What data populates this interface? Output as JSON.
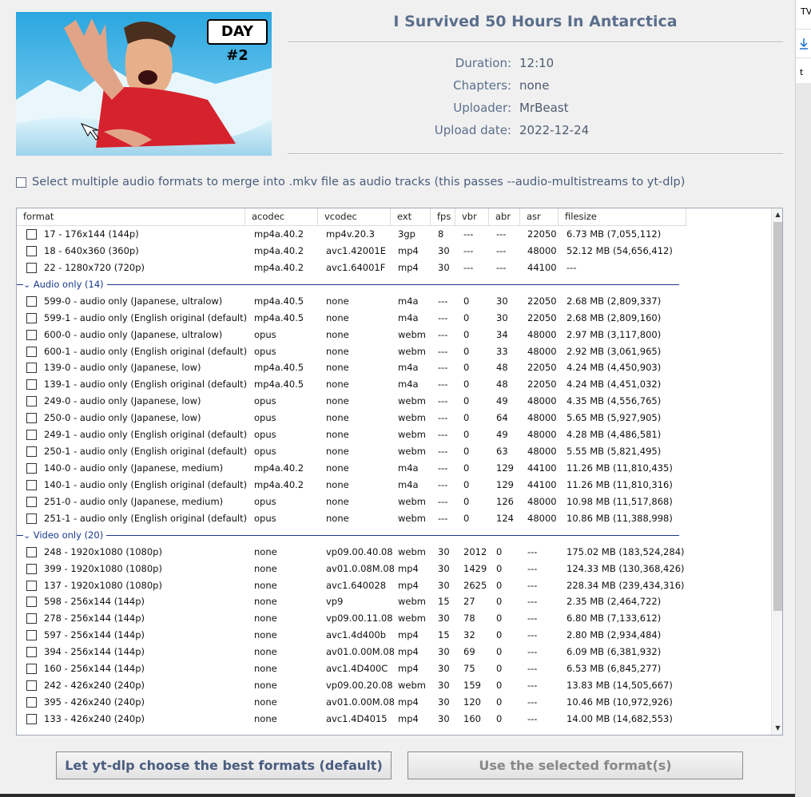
{
  "thumbnail": {
    "overlay_text": "DAY #2"
  },
  "video": {
    "title": "I Survived 50 Hours In Antarctica",
    "meta": [
      {
        "key": "Duration:",
        "value": "12:10"
      },
      {
        "key": "Chapters:",
        "value": "none"
      },
      {
        "key": "Uploader:",
        "value": "MrBeast"
      },
      {
        "key": "Upload date:",
        "value": "2022-12-24"
      }
    ]
  },
  "options": {
    "multi_audio_label": "Select multiple audio formats to merge into .mkv file as audio tracks (this passes --audio-multistreams to yt-dlp)"
  },
  "table": {
    "columns": [
      "format",
      "acodec",
      "vcodec",
      "ext",
      "fps",
      "vbr",
      "abr",
      "asr",
      "filesize"
    ],
    "items": [
      {
        "kind": "row",
        "cells": [
          "17 - 176x144 (144p)",
          "mp4a.40.2",
          "mp4v.20.3",
          "3gp",
          "8",
          "---",
          "---",
          "22050",
          "6.73 MB (7,055,112)"
        ]
      },
      {
        "kind": "row",
        "cells": [
          "18 - 640x360 (360p)",
          "mp4a.40.2",
          "avc1.42001E",
          "mp4",
          "30",
          "---",
          "---",
          "48000",
          "52.12 MB (54,656,412)"
        ]
      },
      {
        "kind": "row",
        "cells": [
          "22 - 1280x720 (720p)",
          "mp4a.40.2",
          "avc1.64001F",
          "mp4",
          "30",
          "---",
          "---",
          "44100",
          "---"
        ]
      },
      {
        "kind": "group",
        "label": "Audio only  (14)"
      },
      {
        "kind": "row",
        "cells": [
          "599-0 - audio only (Japanese, ultralow)",
          "mp4a.40.5",
          "none",
          "m4a",
          "---",
          "0",
          "30",
          "22050",
          "2.68 MB (2,809,337)"
        ]
      },
      {
        "kind": "row",
        "cells": [
          "599-1 - audio only (English original (default), ...",
          "mp4a.40.5",
          "none",
          "m4a",
          "---",
          "0",
          "30",
          "22050",
          "2.68 MB (2,809,160)"
        ]
      },
      {
        "kind": "row",
        "cells": [
          "600-0 - audio only (Japanese, ultralow)",
          "opus",
          "none",
          "webm",
          "---",
          "0",
          "34",
          "48000",
          "2.97 MB (3,117,800)"
        ]
      },
      {
        "kind": "row",
        "cells": [
          "600-1 - audio only (English original (default), ...",
          "opus",
          "none",
          "webm",
          "---",
          "0",
          "33",
          "48000",
          "2.92 MB (3,061,965)"
        ]
      },
      {
        "kind": "row",
        "cells": [
          "139-0 - audio only (Japanese, low)",
          "mp4a.40.5",
          "none",
          "m4a",
          "---",
          "0",
          "48",
          "22050",
          "4.24 MB (4,450,903)"
        ]
      },
      {
        "kind": "row",
        "cells": [
          "139-1 - audio only (English original (default), l...",
          "mp4a.40.5",
          "none",
          "m4a",
          "---",
          "0",
          "48",
          "22050",
          "4.24 MB (4,451,032)"
        ]
      },
      {
        "kind": "row",
        "cells": [
          "249-0 - audio only (Japanese, low)",
          "opus",
          "none",
          "webm",
          "---",
          "0",
          "49",
          "48000",
          "4.35 MB (4,556,765)"
        ]
      },
      {
        "kind": "row",
        "cells": [
          "250-0 - audio only (Japanese, low)",
          "opus",
          "none",
          "webm",
          "---",
          "0",
          "64",
          "48000",
          "5.65 MB (5,927,905)"
        ]
      },
      {
        "kind": "row",
        "cells": [
          "249-1 - audio only (English original (default), l...",
          "opus",
          "none",
          "webm",
          "---",
          "0",
          "49",
          "48000",
          "4.28 MB (4,486,581)"
        ]
      },
      {
        "kind": "row",
        "cells": [
          "250-1 - audio only (English original (default), l...",
          "opus",
          "none",
          "webm",
          "---",
          "0",
          "63",
          "48000",
          "5.55 MB (5,821,495)"
        ]
      },
      {
        "kind": "row",
        "cells": [
          "140-0 - audio only (Japanese, medium)",
          "mp4a.40.2",
          "none",
          "m4a",
          "---",
          "0",
          "129",
          "44100",
          "11.26 MB (11,810,435)"
        ]
      },
      {
        "kind": "row",
        "cells": [
          "140-1 - audio only (English original (default), ...",
          "mp4a.40.2",
          "none",
          "m4a",
          "---",
          "0",
          "129",
          "44100",
          "11.26 MB (11,810,316)"
        ]
      },
      {
        "kind": "row",
        "cells": [
          "251-0 - audio only (Japanese, medium)",
          "opus",
          "none",
          "webm",
          "---",
          "0",
          "126",
          "48000",
          "10.98 MB (11,517,868)"
        ]
      },
      {
        "kind": "row",
        "cells": [
          "251-1 - audio only (English original (default), ...",
          "opus",
          "none",
          "webm",
          "---",
          "0",
          "124",
          "48000",
          "10.86 MB (11,388,998)"
        ]
      },
      {
        "kind": "group",
        "label": "Video only  (20)"
      },
      {
        "kind": "row",
        "cells": [
          "248 - 1920x1080 (1080p)",
          "none",
          "vp09.00.40.08",
          "webm",
          "30",
          "2012",
          "0",
          "---",
          "175.02 MB (183,524,284)"
        ]
      },
      {
        "kind": "row",
        "cells": [
          "399 - 1920x1080 (1080p)",
          "none",
          "av01.0.08M.08",
          "mp4",
          "30",
          "1429",
          "0",
          "---",
          "124.33 MB (130,368,426)"
        ]
      },
      {
        "kind": "row",
        "cells": [
          "137 - 1920x1080 (1080p)",
          "none",
          "avc1.640028",
          "mp4",
          "30",
          "2625",
          "0",
          "---",
          "228.34 MB (239,434,316)"
        ]
      },
      {
        "kind": "row",
        "cells": [
          "598 - 256x144 (144p)",
          "none",
          "vp9",
          "webm",
          "15",
          "27",
          "0",
          "---",
          "2.35 MB (2,464,722)"
        ]
      },
      {
        "kind": "row",
        "cells": [
          "278 - 256x144 (144p)",
          "none",
          "vp09.00.11.08",
          "webm",
          "30",
          "78",
          "0",
          "---",
          "6.80 MB (7,133,612)"
        ]
      },
      {
        "kind": "row",
        "cells": [
          "597 - 256x144 (144p)",
          "none",
          "avc1.4d400b",
          "mp4",
          "15",
          "32",
          "0",
          "---",
          "2.80 MB (2,934,484)"
        ]
      },
      {
        "kind": "row",
        "cells": [
          "394 - 256x144 (144p)",
          "none",
          "av01.0.00M.08",
          "mp4",
          "30",
          "69",
          "0",
          "---",
          "6.09 MB (6,381,932)"
        ]
      },
      {
        "kind": "row",
        "cells": [
          "160 - 256x144 (144p)",
          "none",
          "avc1.4D400C",
          "mp4",
          "30",
          "75",
          "0",
          "---",
          "6.53 MB (6,845,277)"
        ]
      },
      {
        "kind": "row",
        "cells": [
          "242 - 426x240 (240p)",
          "none",
          "vp09.00.20.08",
          "webm",
          "30",
          "159",
          "0",
          "---",
          "13.83 MB (14,505,667)"
        ]
      },
      {
        "kind": "row",
        "cells": [
          "395 - 426x240 (240p)",
          "none",
          "av01.0.00M.08",
          "mp4",
          "30",
          "120",
          "0",
          "---",
          "10.46 MB (10,972,926)"
        ]
      },
      {
        "kind": "row",
        "cells": [
          "133 - 426x240 (240p)",
          "none",
          "avc1.4D4015",
          "mp4",
          "30",
          "160",
          "0",
          "---",
          "14.00 MB (14,682,553)"
        ]
      }
    ]
  },
  "buttons": {
    "best": "Let yt-dlp choose the best formats (default)",
    "selected": "Use the selected format(s)"
  },
  "side": {
    "tab_text": "TV",
    "partial_text": "t"
  },
  "colors": {
    "accent": "#5b6e8c",
    "group": "#1a3a8c"
  }
}
